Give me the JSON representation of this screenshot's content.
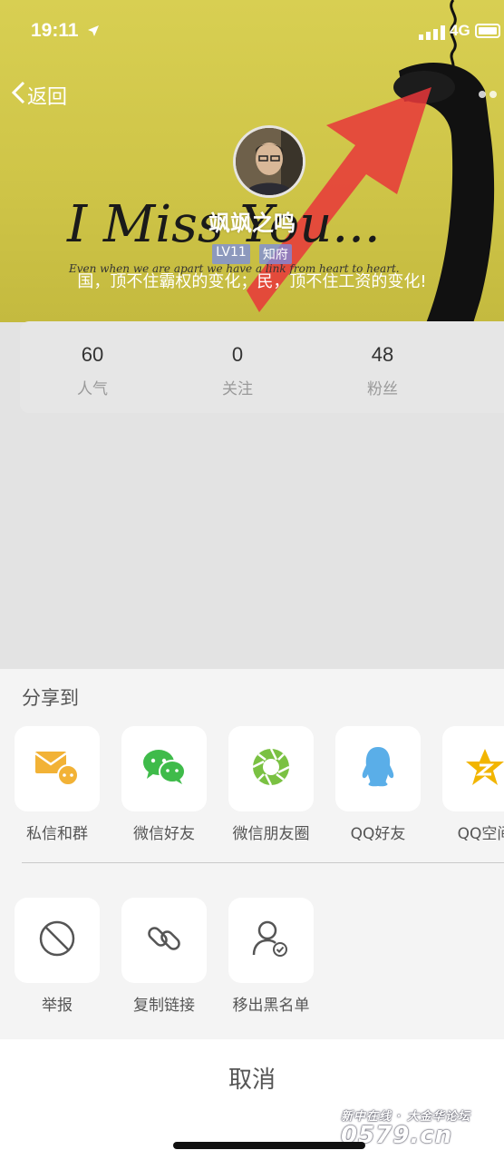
{
  "status_bar": {
    "time": "19:11",
    "network": "4G"
  },
  "nav": {
    "back_label": "返回"
  },
  "cover": {
    "art_text": "I Miss You...",
    "art_subtext": "Even when we are apart we have a link from heart to heart."
  },
  "profile": {
    "username": "飒飒之鸣",
    "badges": [
      "LV11",
      "知府"
    ],
    "bio": "国，顶不住霸权的变化；民，顶不住工资的变化!"
  },
  "stats": [
    {
      "value": "60",
      "label": "人气"
    },
    {
      "value": "0",
      "label": "关注"
    },
    {
      "value": "48",
      "label": "粉丝"
    }
  ],
  "share_sheet": {
    "title": "分享到",
    "share_targets": [
      {
        "label": "私信和群",
        "icon": "envelope-chat-icon"
      },
      {
        "label": "微信好友",
        "icon": "wechat-icon"
      },
      {
        "label": "微信朋友圈",
        "icon": "wechat-moments-icon"
      },
      {
        "label": "QQ好友",
        "icon": "qq-icon"
      },
      {
        "label": "QQ空间",
        "icon": "qzone-icon"
      }
    ],
    "actions": [
      {
        "label": "举报",
        "icon": "block-icon"
      },
      {
        "label": "复制链接",
        "icon": "link-icon"
      },
      {
        "label": "移出黑名单",
        "icon": "user-check-icon"
      }
    ],
    "cancel_label": "取消"
  },
  "watermark": {
    "line1": "新中在线 · 大金华论坛",
    "line2": "0579.cn"
  },
  "colors": {
    "cover_yellow": "#d4cb4c",
    "wechat_green": "#3fbb4a",
    "qq_blue": "#5aaee8",
    "qzone_gold": "#f2b500",
    "mail_orange": "#f2b236"
  }
}
